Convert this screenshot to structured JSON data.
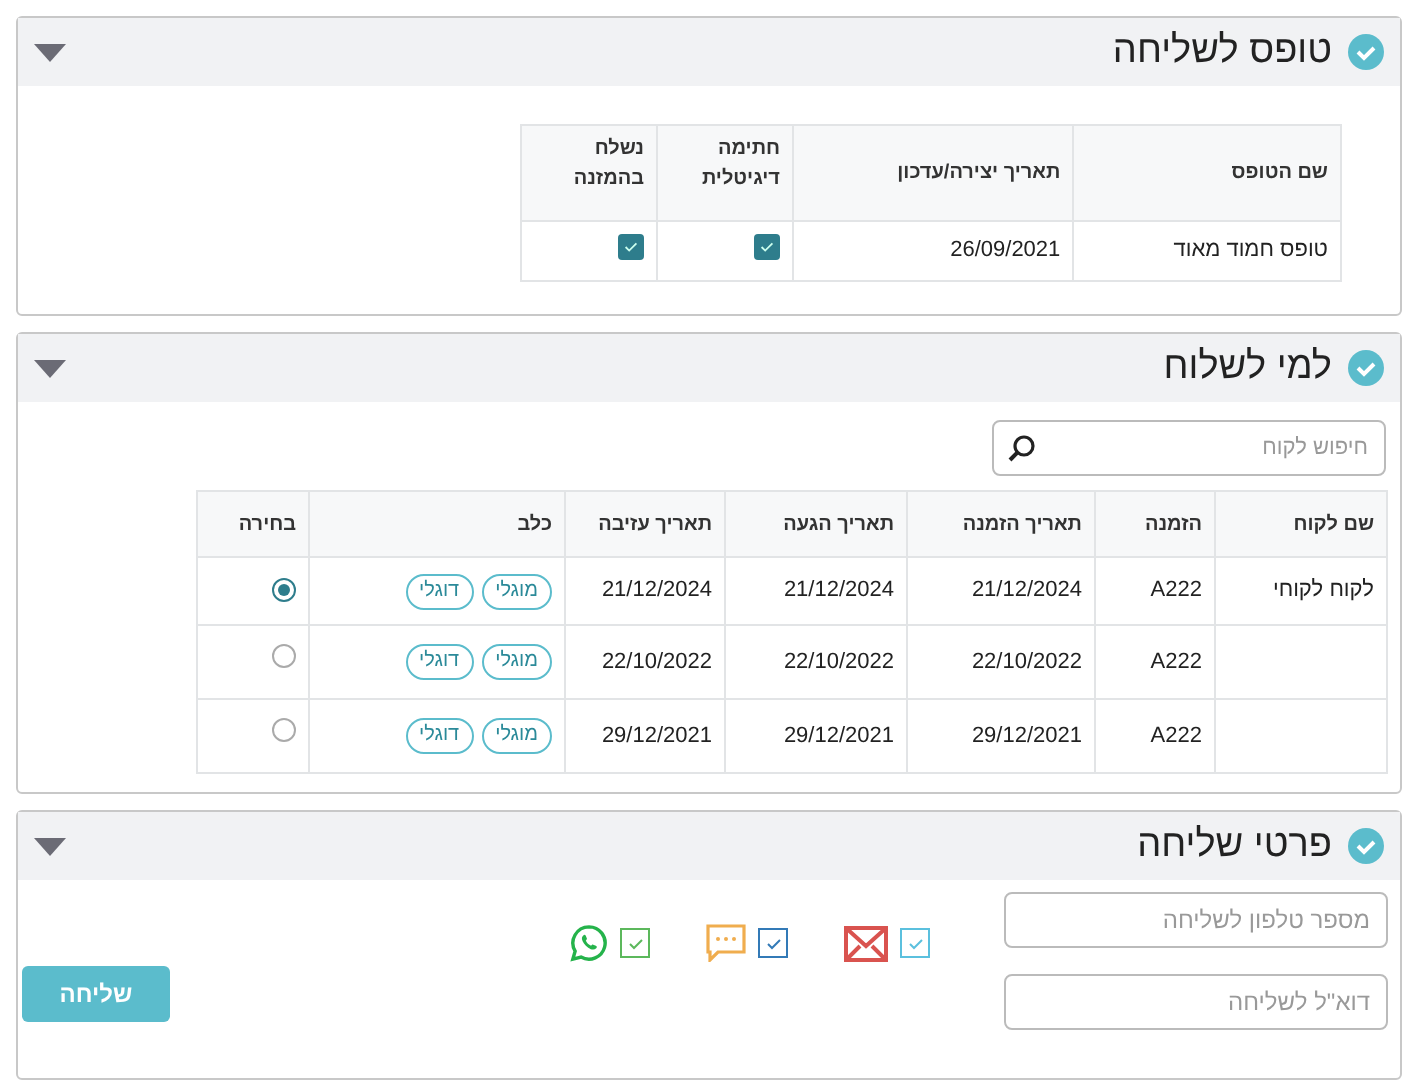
{
  "form_section": {
    "title": "טופס לשליחה",
    "columns": [
      "שם הטופס",
      "תאריך יצירה/עדכון",
      "חתימה דיגיטלית",
      "נשלח בהמזנה"
    ],
    "rows": [
      {
        "name": "טופס חמוד מאוד",
        "date": "26/09/2021",
        "digital_signature": true,
        "sent_in_order": true
      }
    ]
  },
  "recipients_section": {
    "title": "למי לשלוח",
    "search": {
      "placeholder": "חיפוש לקוח"
    },
    "columns": [
      "שם לקוח",
      "הזמנה",
      "תאריך הזמנה",
      "תאריך הגעה",
      "תאריך עזיבה",
      "כלב",
      "בחירה"
    ],
    "rows": [
      {
        "customer": "לקוח לקוחי",
        "order": "A222",
        "order_date": "21/12/2024",
        "arrival": "21/12/2024",
        "departure": "21/12/2024",
        "dogs": [
          "מוגלי",
          "דוגלי"
        ],
        "selected": true
      },
      {
        "order": "A222",
        "order_date": "22/10/2022",
        "arrival": "22/10/2022",
        "departure": "22/10/2022",
        "dogs": [
          "מוגלי",
          "דוגלי"
        ],
        "selected": false
      },
      {
        "order": "A222",
        "order_date": "29/12/2021",
        "arrival": "29/12/2021",
        "departure": "29/12/2021",
        "dogs": [
          "מוגלי",
          "דוגלי"
        ],
        "selected": false
      }
    ]
  },
  "sending_section": {
    "title": "פרטי שליחה",
    "phone": {
      "placeholder": "מספר טלפון לשליחה"
    },
    "email": {
      "placeholder": "דוא\"ל לשליחה"
    },
    "channels": [
      {
        "kind": "email",
        "checked": true,
        "color": "#5bc0de"
      },
      {
        "kind": "sms",
        "checked": true,
        "color": "#337ab7"
      },
      {
        "kind": "whatsapp",
        "checked": true,
        "color": "#5cb85c"
      }
    ],
    "send_button": "שליחה"
  }
}
